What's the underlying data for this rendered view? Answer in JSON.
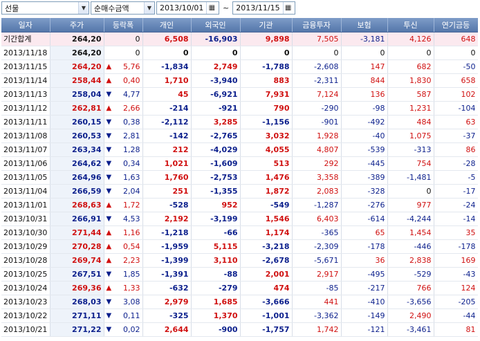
{
  "toolbar": {
    "market": "선물",
    "metric": "순매수금액",
    "start_date": "2013/10/01",
    "end_date": "2013/11/15",
    "separator": "~"
  },
  "colors": {
    "up": "#d01010",
    "down": "#0b1f8c",
    "header_bg": "#5f80b4",
    "sum_bg": "#fbe9ef"
  },
  "columns": [
    "일자",
    "주가",
    "등락폭",
    "개인",
    "외국인",
    "기관",
    "금융투자",
    "보험",
    "투신",
    "연기금등"
  ],
  "rows": [
    {
      "date": "기간합계",
      "price": "264,20",
      "dir": "",
      "chg": "0",
      "ind": "6,508",
      "frn": "-16,903",
      "inst": "9,898",
      "fin": "7,505",
      "ins": "-3,181",
      "inv": "4,126",
      "pen": "648",
      "sum": true
    },
    {
      "date": "2013/11/18",
      "price": "264,20",
      "dir": "",
      "chg": "0",
      "ind": "0",
      "frn": "0",
      "inst": "0",
      "fin": "0",
      "ins": "0",
      "inv": "0",
      "pen": "0"
    },
    {
      "date": "2013/11/15",
      "price": "264,20",
      "dir": "up",
      "chg": "5,76",
      "ind": "-1,834",
      "frn": "2,749",
      "inst": "-1,788",
      "fin": "-2,608",
      "ins": "147",
      "inv": "682",
      "pen": "-50"
    },
    {
      "date": "2013/11/14",
      "price": "258,44",
      "dir": "up",
      "chg": "0,40",
      "ind": "1,710",
      "frn": "-3,940",
      "inst": "883",
      "fin": "-2,311",
      "ins": "844",
      "inv": "1,830",
      "pen": "658"
    },
    {
      "date": "2013/11/13",
      "price": "258,04",
      "dir": "down",
      "chg": "4,77",
      "ind": "45",
      "frn": "-6,921",
      "inst": "7,931",
      "fin": "7,124",
      "ins": "136",
      "inv": "587",
      "pen": "102"
    },
    {
      "date": "2013/11/12",
      "price": "262,81",
      "dir": "up",
      "chg": "2,66",
      "ind": "-214",
      "frn": "-921",
      "inst": "790",
      "fin": "-290",
      "ins": "-98",
      "inv": "1,231",
      "pen": "-104"
    },
    {
      "date": "2013/11/11",
      "price": "260,15",
      "dir": "down",
      "chg": "0,38",
      "ind": "-2,112",
      "frn": "3,285",
      "inst": "-1,156",
      "fin": "-901",
      "ins": "-492",
      "inv": "484",
      "pen": "63"
    },
    {
      "date": "2013/11/08",
      "price": "260,53",
      "dir": "down",
      "chg": "2,81",
      "ind": "-142",
      "frn": "-2,765",
      "inst": "3,032",
      "fin": "1,928",
      "ins": "-40",
      "inv": "1,075",
      "pen": "-37"
    },
    {
      "date": "2013/11/07",
      "price": "263,34",
      "dir": "down",
      "chg": "1,28",
      "ind": "212",
      "frn": "-4,029",
      "inst": "4,055",
      "fin": "4,807",
      "ins": "-539",
      "inv": "-313",
      "pen": "86"
    },
    {
      "date": "2013/11/06",
      "price": "264,62",
      "dir": "down",
      "chg": "0,34",
      "ind": "1,021",
      "frn": "-1,609",
      "inst": "513",
      "fin": "292",
      "ins": "-445",
      "inv": "754",
      "pen": "-28"
    },
    {
      "date": "2013/11/05",
      "price": "264,96",
      "dir": "down",
      "chg": "1,63",
      "ind": "1,760",
      "frn": "-2,753",
      "inst": "1,476",
      "fin": "3,358",
      "ins": "-389",
      "inv": "-1,481",
      "pen": "-5"
    },
    {
      "date": "2013/11/04",
      "price": "266,59",
      "dir": "down",
      "chg": "2,04",
      "ind": "251",
      "frn": "-1,355",
      "inst": "1,872",
      "fin": "2,083",
      "ins": "-328",
      "inv": "0",
      "pen": "-17"
    },
    {
      "date": "2013/11/01",
      "price": "268,63",
      "dir": "up",
      "chg": "1,72",
      "ind": "-528",
      "frn": "952",
      "inst": "-549",
      "fin": "-1,287",
      "ins": "-276",
      "inv": "977",
      "pen": "-24"
    },
    {
      "date": "2013/10/31",
      "price": "266,91",
      "dir": "down",
      "chg": "4,53",
      "ind": "2,192",
      "frn": "-3,199",
      "inst": "1,546",
      "fin": "6,403",
      "ins": "-614",
      "inv": "-4,244",
      "pen": "-14"
    },
    {
      "date": "2013/10/30",
      "price": "271,44",
      "dir": "up",
      "chg": "1,16",
      "ind": "-1,218",
      "frn": "-66",
      "inst": "1,174",
      "fin": "-365",
      "ins": "65",
      "inv": "1,454",
      "pen": "35"
    },
    {
      "date": "2013/10/29",
      "price": "270,28",
      "dir": "up",
      "chg": "0,54",
      "ind": "-1,959",
      "frn": "5,115",
      "inst": "-3,218",
      "fin": "-2,309",
      "ins": "-178",
      "inv": "-446",
      "pen": "-178"
    },
    {
      "date": "2013/10/28",
      "price": "269,74",
      "dir": "up",
      "chg": "2,23",
      "ind": "-1,399",
      "frn": "3,110",
      "inst": "-2,678",
      "fin": "-5,671",
      "ins": "36",
      "inv": "2,838",
      "pen": "169"
    },
    {
      "date": "2013/10/25",
      "price": "267,51",
      "dir": "down",
      "chg": "1,85",
      "ind": "-1,391",
      "frn": "-88",
      "inst": "2,001",
      "fin": "2,917",
      "ins": "-495",
      "inv": "-529",
      "pen": "-43"
    },
    {
      "date": "2013/10/24",
      "price": "269,36",
      "dir": "up",
      "chg": "1,33",
      "ind": "-632",
      "frn": "-279",
      "inst": "474",
      "fin": "-85",
      "ins": "-217",
      "inv": "766",
      "pen": "124"
    },
    {
      "date": "2013/10/23",
      "price": "268,03",
      "dir": "down",
      "chg": "3,08",
      "ind": "2,979",
      "frn": "1,685",
      "inst": "-3,666",
      "fin": "441",
      "ins": "-410",
      "inv": "-3,656",
      "pen": "-205"
    },
    {
      "date": "2013/10/22",
      "price": "271,11",
      "dir": "down",
      "chg": "0,11",
      "ind": "-325",
      "frn": "1,370",
      "inst": "-1,001",
      "fin": "-3,362",
      "ins": "-149",
      "inv": "2,490",
      "pen": "-44"
    },
    {
      "date": "2013/10/21",
      "price": "271,22",
      "dir": "down",
      "chg": "0,02",
      "ind": "2,644",
      "frn": "-900",
      "inst": "-1,757",
      "fin": "1,742",
      "ins": "-121",
      "inv": "-3,461",
      "pen": "81"
    }
  ]
}
